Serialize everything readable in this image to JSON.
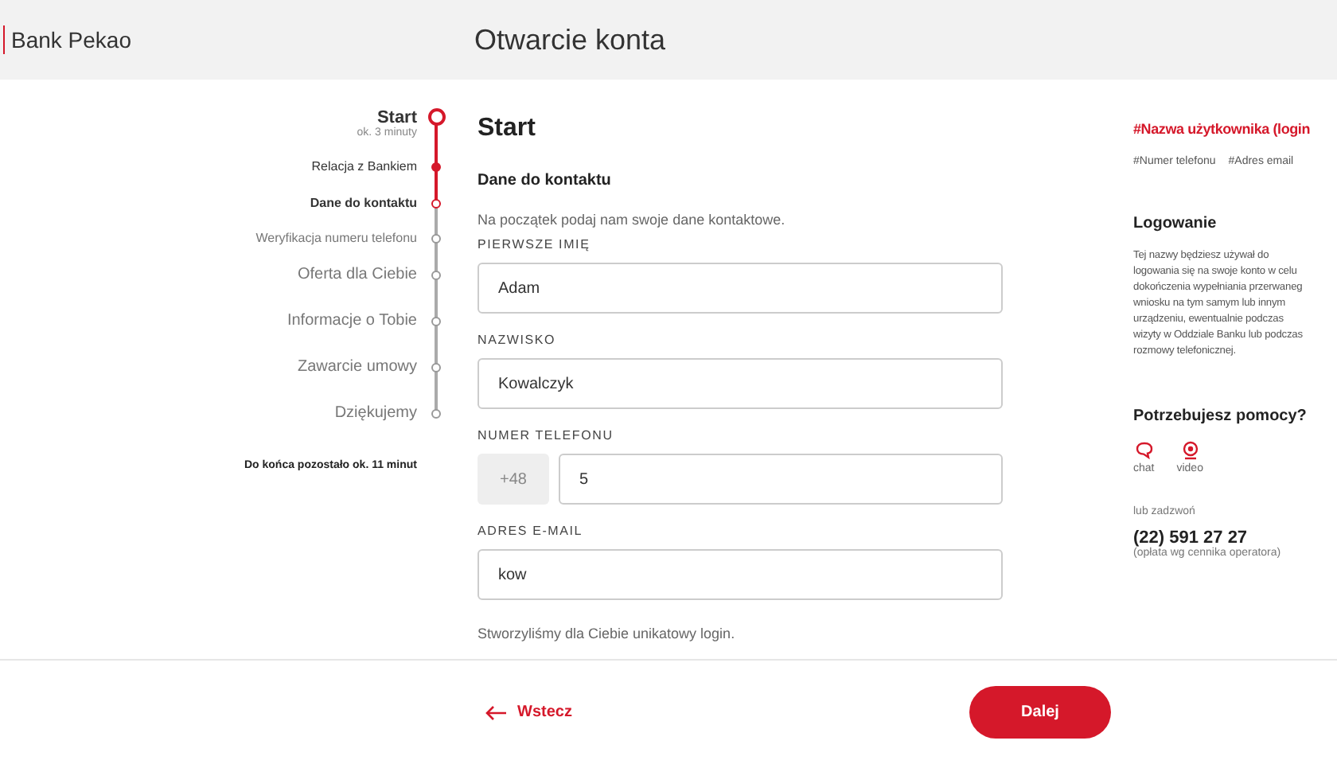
{
  "header": {
    "logo": "Bank Pekao",
    "title": "Otwarcie konta"
  },
  "steps": [
    {
      "label": "Start",
      "sub": "ok. 3 minuty",
      "kind": "section",
      "done": false,
      "current": true
    },
    {
      "label": "Relacja z Bankiem",
      "kind": "substep",
      "done": true,
      "current": false
    },
    {
      "label": "Dane do kontaktu",
      "kind": "substep",
      "done": false,
      "current": true
    },
    {
      "label": "Weryfikacja numeru telefonu",
      "kind": "substep",
      "done": false,
      "current": false
    },
    {
      "label": "Oferta dla Ciebie",
      "kind": "section",
      "done": false,
      "current": false
    },
    {
      "label": "Informacje o Tobie",
      "kind": "section",
      "done": false,
      "current": false
    },
    {
      "label": "Zawarcie umowy",
      "kind": "section",
      "done": false,
      "current": false
    },
    {
      "label": "Dziękujemy",
      "kind": "section",
      "done": false,
      "current": false
    }
  ],
  "remaining": "Do końca pozostało ok. 11 minut",
  "form": {
    "title": "Start",
    "section": "Dane do kontaktu",
    "intro": "Na początek podaj nam swoje dane kontaktowe.",
    "fields": [
      {
        "label": "PIERWSZE IMIĘ",
        "value": "Adam"
      },
      {
        "label": "NAZWISKO",
        "value": "Kowalczyk"
      },
      {
        "label": "NUMER TELEFONU",
        "prefix": "+48",
        "value": "5"
      },
      {
        "label": "ADRES E-MAIL",
        "value": "kow"
      }
    ],
    "note": "Stworzyliśmy dla Ciebie unikatowy login."
  },
  "aside": {
    "login_title": "#Nazwa użytkownika (login",
    "tags": [
      "#Numer telefonu",
      "#Adres email"
    ],
    "heading": "Logowanie",
    "text_lines": [
      "Tej nazwy będziesz używał do",
      "logowania się na swoje konto w celu",
      "dokończenia wypełniania przerwaneg",
      "wniosku na tym samym lub innym",
      "urządzeniu, ewentualnie podczas",
      "wizyty w Oddziale Banku lub podczas",
      "rozmowy telefonicznej."
    ],
    "help": "Potrzebujesz pomocy?",
    "contacts": [
      {
        "kind": "chat",
        "label": "chat"
      },
      {
        "kind": "video",
        "label": "video"
      }
    ],
    "call": "lub zadzwoń",
    "phone": "(22) 591 27 27",
    "fee": "(opłata wg cennika operatora)"
  },
  "footer": {
    "back": "Wstecz",
    "next": "Dalej"
  }
}
